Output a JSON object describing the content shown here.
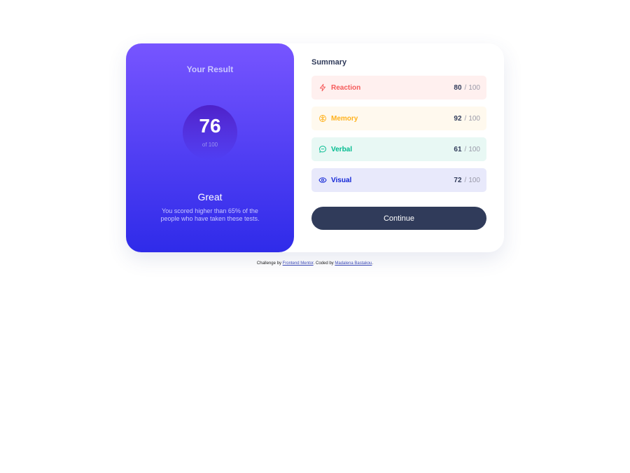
{
  "result": {
    "heading": "Your Result",
    "score": "76",
    "of_label": "of 100",
    "rating": "Great",
    "description": "You scored higher than 65% of the people who have taken these tests."
  },
  "summary": {
    "title": "Summary",
    "items": [
      {
        "label": "Reaction",
        "score": "80",
        "total": "100",
        "icon": "lightning-icon",
        "color": "#f55b5b",
        "bg": "#fff0ef"
      },
      {
        "label": "Memory",
        "score": "92",
        "total": "100",
        "icon": "brain-icon",
        "color": "#ffb21e",
        "bg": "#fff9ee"
      },
      {
        "label": "Verbal",
        "score": "61",
        "total": "100",
        "icon": "chat-bubble-icon",
        "color": "#00bb8f",
        "bg": "#e8f8f4"
      },
      {
        "label": "Visual",
        "score": "72",
        "total": "100",
        "icon": "eye-icon",
        "color": "#1125d6",
        "bg": "#e8e9fb"
      }
    ],
    "continue_label": "Continue"
  },
  "footer": {
    "prefix": "Challenge by ",
    "link1": "Frontend Mentor",
    "middle": ". Coded by ",
    "link2": "Madalena Bastakou",
    "suffix": "."
  }
}
